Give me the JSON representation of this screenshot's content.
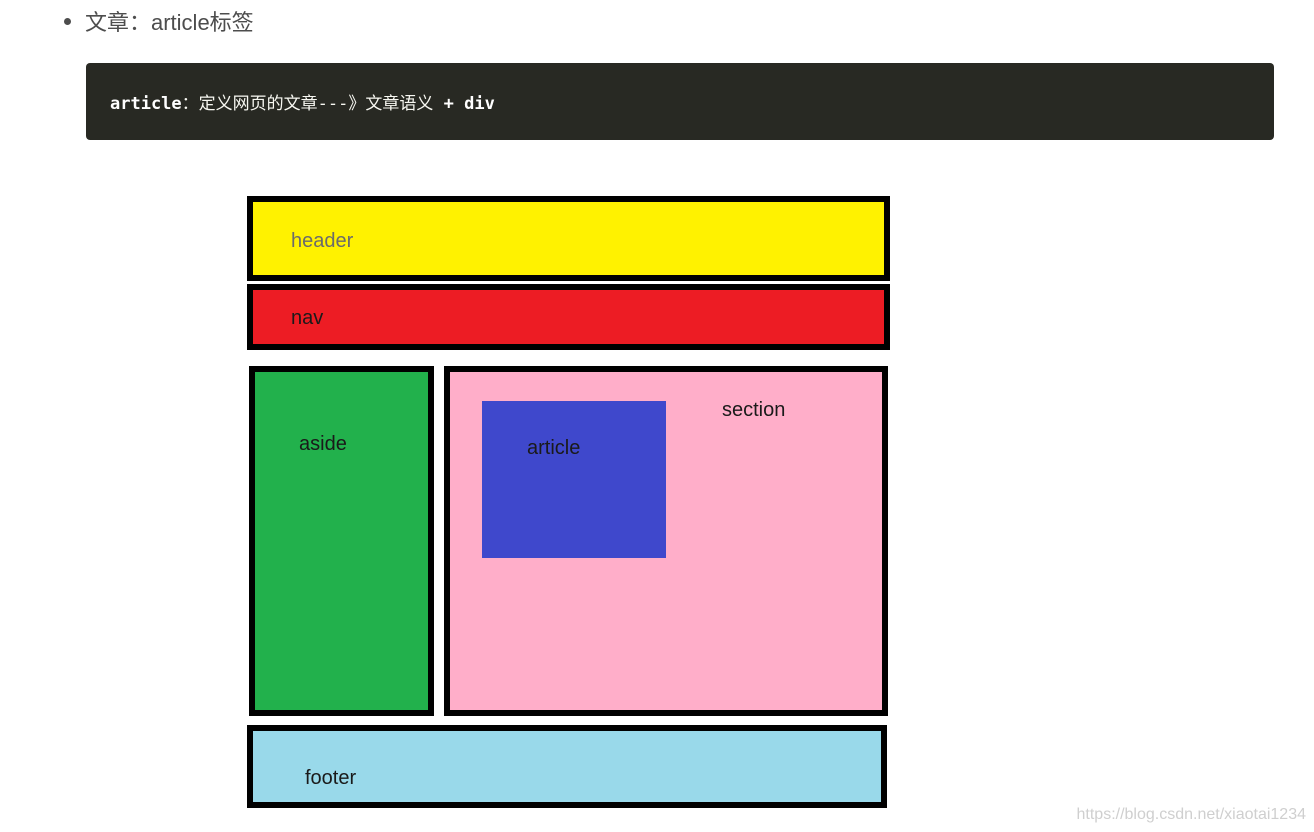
{
  "bullet": {
    "text": "文章：article标签"
  },
  "code": {
    "keyword": "article",
    "rest": "：定义网页的文章---》文章语义 ",
    "plus": "+",
    "div": "div"
  },
  "diagram": {
    "header": {
      "label": "header",
      "color": "#fff200",
      "label_color": "#6b6b6b"
    },
    "nav": {
      "label": "nav",
      "color": "#ed1c24"
    },
    "aside": {
      "label": "aside",
      "color": "#22b14c"
    },
    "section": {
      "label": "section",
      "color": "#ffaec9"
    },
    "article": {
      "label": "article",
      "color": "#3f48cc"
    },
    "footer": {
      "label": "footer",
      "color": "#99d9ea"
    }
  },
  "watermark": {
    "text": "https://blog.csdn.net/xiaotai1234"
  }
}
